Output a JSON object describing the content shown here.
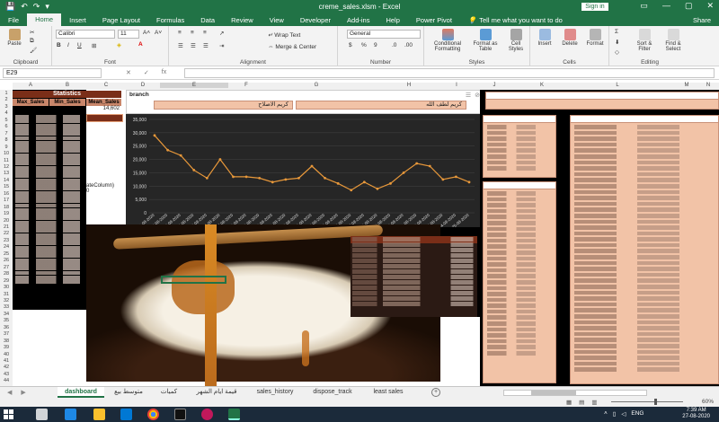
{
  "window": {
    "title": "creme_sales.xlsm  -  Excel",
    "signin": "Sign in",
    "share": "Share"
  },
  "ribbon_tabs": [
    "File",
    "Home",
    "Insert",
    "Page Layout",
    "Formulas",
    "Data",
    "Review",
    "View",
    "Developer",
    "Add-ins",
    "Help",
    "Power Pivot"
  ],
  "tell_me": "Tell me what you want to do",
  "clipboard": {
    "paste": "Paste",
    "label": "Clipboard"
  },
  "font": {
    "name": "Calibri",
    "size": "11",
    "label": "Font"
  },
  "alignment": {
    "wrap": "Wrap Text",
    "merge": "Merge & Center",
    "label": "Alignment"
  },
  "number": {
    "format": "General",
    "currency": "$",
    "percent": "%",
    "comma": "9",
    "label": "Number"
  },
  "styles": {
    "conditional": "Conditional Formatting",
    "format_table": "Format as Table",
    "cell_styles": "Cell Styles",
    "label": "Styles"
  },
  "cells": {
    "insert": "Insert",
    "delete": "Delete",
    "format": "Format",
    "label": "Cells"
  },
  "editing": {
    "sort": "Sort & Filter",
    "find": "Find & Select",
    "label": "Editing"
  },
  "formula_bar": {
    "name_box": "E29",
    "fx": "fx",
    "cancel": "✕",
    "enter": "✓",
    "value": ""
  },
  "columns": [
    "A",
    "B",
    "C",
    "D",
    "E",
    "F",
    "G",
    "H",
    "I",
    "J",
    "K",
    "L",
    "M",
    "N"
  ],
  "rows": [
    "1",
    "2",
    "3",
    "4",
    "5",
    "6",
    "7",
    "8",
    "9",
    "10",
    "11",
    "12",
    "13",
    "14",
    "15",
    "16",
    "17",
    "18",
    "19",
    "20",
    "21",
    "22",
    "23",
    "24",
    "25",
    "26",
    "27",
    "28",
    "29",
    "30",
    "31",
    "32",
    "33",
    "34",
    "35",
    "36",
    "37",
    "38",
    "39",
    "40",
    "41",
    "42",
    "43",
    "44"
  ],
  "stats": {
    "title": "Statistics",
    "headers": [
      "Max_Sales",
      "Min_Sales",
      "Mean_Sales"
    ],
    "mean_value": "14,602",
    "date_label": "ateColumn)",
    "date_label2": "0"
  },
  "branch": {
    "label": "branch",
    "btn1": "كريم الاصلاح",
    "btn2": "كريم لطف الله"
  },
  "chart_data": {
    "type": "line",
    "title": "",
    "xlabel": "",
    "ylabel": "",
    "ylim": [
      0,
      35000
    ],
    "yticks": [
      "0",
      "5,000",
      "10,000",
      "15,000",
      "20,000",
      "25,000",
      "30,000",
      "35,000"
    ],
    "x": [
      "1-08-2020",
      "2-08-2020",
      "3-08-2020",
      "4-08-2020",
      "5-08-2020",
      "6-08-2020",
      "7-08-2020",
      "8-08-2020",
      "9-08-2020",
      "10-08-2020",
      "11-08-2020",
      "12-08-2020",
      "13-08-2020",
      "14-08-2020",
      "15-08-2020",
      "16-08-2020",
      "17-08-2020",
      "18-08-2020",
      "19-08-2020",
      "20-08-2020",
      "21-08-2020",
      "22-08-2020",
      "23-08-2020",
      "24-08-2020",
      "25-08-2020"
    ],
    "values": [
      29000,
      23500,
      21500,
      16000,
      13000,
      20000,
      13500,
      13500,
      13000,
      11500,
      12500,
      13000,
      17500,
      13000,
      11000,
      8500,
      11500,
      9000,
      11000,
      15000,
      18500,
      17500,
      12500,
      13500,
      11500
    ],
    "color": "#e8983a",
    "grid": true
  },
  "sheet_tabs": [
    "dashboard",
    "متوسط بيع",
    "كميات",
    "قيمة ايام الشهر",
    "sales_history",
    "dispose_track",
    "least sales"
  ],
  "active_tab": "dashboard",
  "status": {
    "zoom": "60%"
  },
  "taskbar": {
    "lang": "ENG",
    "time": "7:39 AM",
    "date": "27-08-2020"
  }
}
